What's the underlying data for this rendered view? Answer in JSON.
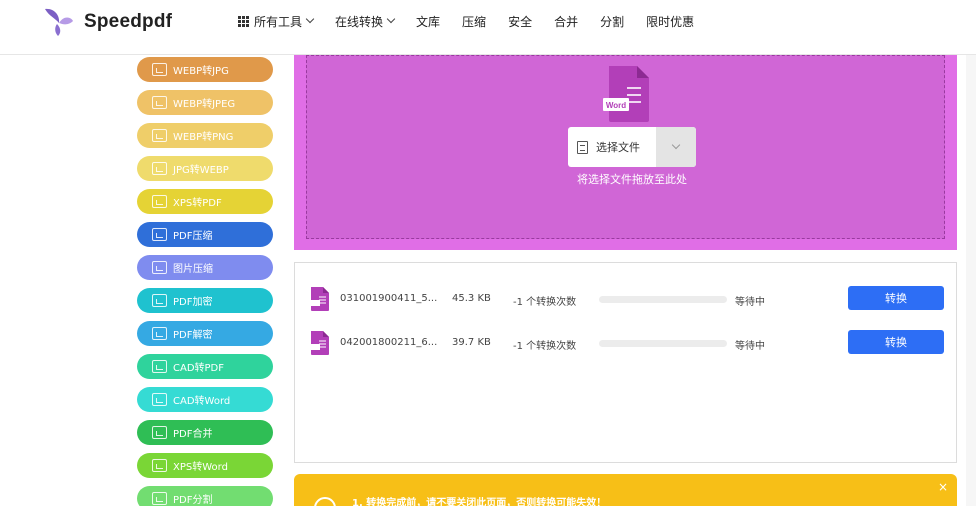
{
  "header": {
    "logo_text": "Speedpdf",
    "nav": [
      {
        "label": "所有工具",
        "has_grid": true,
        "has_chevron": true
      },
      {
        "label": "在线转换",
        "has_grid": false,
        "has_chevron": true
      },
      {
        "label": "文库",
        "has_grid": false,
        "has_chevron": false
      },
      {
        "label": "压缩",
        "has_grid": false,
        "has_chevron": false
      },
      {
        "label": "安全",
        "has_grid": false,
        "has_chevron": false
      },
      {
        "label": "合并",
        "has_grid": false,
        "has_chevron": false
      },
      {
        "label": "分割",
        "has_grid": false,
        "has_chevron": false
      },
      {
        "label": "限时优惠",
        "has_grid": false,
        "has_chevron": false
      }
    ]
  },
  "sidebar": {
    "items": [
      {
        "label": "",
        "color": "#f4c97d"
      },
      {
        "label": "WEBP转JPG",
        "color": "#e0994a"
      },
      {
        "label": "WEBP转JPEG",
        "color": "#efc267"
      },
      {
        "label": "WEBP转PNG",
        "color": "#efce69"
      },
      {
        "label": "JPG转WEBP",
        "color": "#efdb6c"
      },
      {
        "label": "XPS转PDF",
        "color": "#e5d335"
      },
      {
        "label": "PDF压缩",
        "color": "#2f6fd9"
      },
      {
        "label": "图片压缩",
        "color": "#7f8cef"
      },
      {
        "label": "PDF加密",
        "color": "#1fc2cf"
      },
      {
        "label": "PDF解密",
        "color": "#35a9e3"
      },
      {
        "label": "CAD转PDF",
        "color": "#2fd39c"
      },
      {
        "label": "CAD转Word",
        "color": "#35dbd4"
      },
      {
        "label": "PDF合并",
        "color": "#2fbe55"
      },
      {
        "label": "XPS转Word",
        "color": "#7ad636"
      },
      {
        "label": "PDF分割",
        "color": "#72dd71"
      }
    ]
  },
  "upload": {
    "icon_label": "Word",
    "select_label": "选择文件",
    "drop_hint": "将选择文件拖放至此处",
    "outer_color": "#e06ee6",
    "inner_color": "#d066d6"
  },
  "files": [
    {
      "name": "031001900411_5...",
      "size": "45.3 KB",
      "count": "-1 个转换次数",
      "progress": 0,
      "status": "等待中",
      "action": "转换"
    },
    {
      "name": "042001800211_6...",
      "size": "39.7 KB",
      "count": "-1 个转换次数",
      "progress": 0,
      "status": "等待中",
      "action": "转换"
    }
  ],
  "notice": {
    "text": "1. 转换完成前，请不要关闭此页面，否则转换可能失效！",
    "close": "×",
    "color": "#f7bf17"
  },
  "accent": "#2d6ef5"
}
